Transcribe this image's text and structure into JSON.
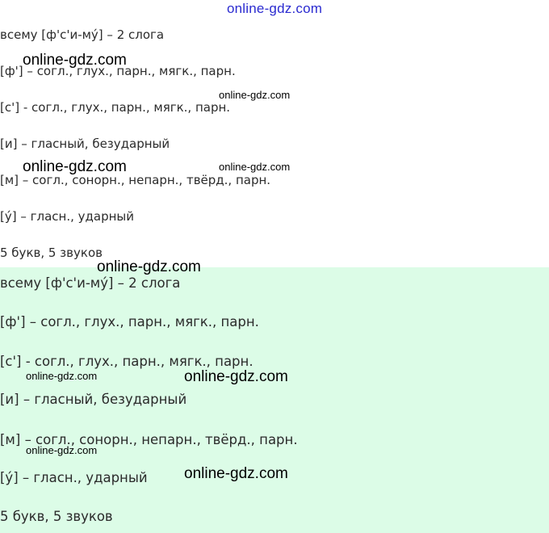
{
  "watermark": "online-gdz.com",
  "blocks": [
    {
      "lines": [
        "всему [ф'с'и-му́] – 2 слога",
        "[ф'] – согл., глух., парн., мягк., парн.",
        "[с'] - согл., глух., парн., мягк., парн.",
        "[и] – гласный, безударный",
        "[м] – согл., сонорн., непарн., твёрд., парн.",
        "[у́] – гласн., ударный",
        "5 букв, 5 звуков"
      ]
    },
    {
      "lines": [
        "всему [ф'с'и-му́] – 2 слога",
        "[ф'] – согл., глух., парн., мягк., парн.",
        "[с'] - согл., глух., парн., мягк., парн.",
        "[и] – гласный, безударный",
        "[м] – согл., сонорн., непарн., твёрд., парн.",
        "[у́] – гласн., ударный",
        "5 букв, 5 звуков"
      ]
    }
  ],
  "colors": {
    "text": "#2b2b2b",
    "highlight_background": "#dcfce7",
    "watermark": "#000000",
    "header_watermark": "#2b2bd0"
  }
}
